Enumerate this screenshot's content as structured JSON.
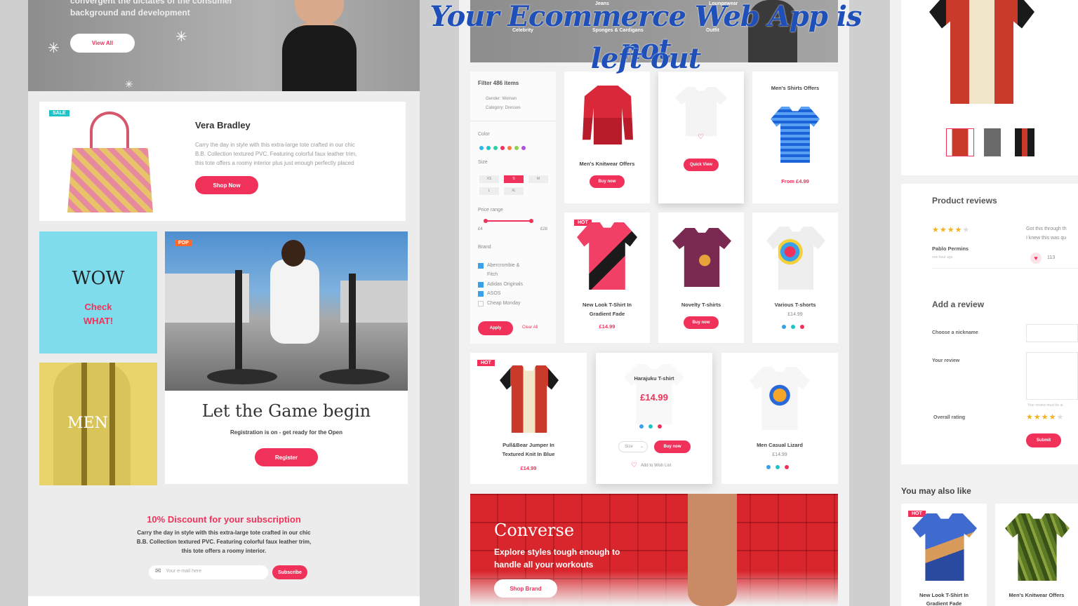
{
  "overlay_title": {
    "line1": "Your Ecommerce Web App is not",
    "line2": "left out"
  },
  "colors": {
    "accent": "#f0325b",
    "teal": "#1fc3c7",
    "sky": "#7edcec",
    "mustard": "#e8d46a",
    "overlay_text": "#1f4fb8"
  },
  "left": {
    "hero": {
      "subtitle_top": "convergent the dictates of the consumer",
      "subtitle": "background and development",
      "button": "View All"
    },
    "feature": {
      "badge": "SALE",
      "title": "Vera Bradley",
      "desc1": "Carry the day in style with this extra-large tote crafted in our chic",
      "desc2": "B.B. Collection textured PVC. Featuring colorful faux leather trim,",
      "desc3": "this tote offers a roomy interior plus just enough perfectly placed",
      "button": "Shop Now"
    },
    "wow": {
      "title": "WOW",
      "line1": "Check",
      "line2": "WHAT!"
    },
    "men": {
      "title": "MEN"
    },
    "game": {
      "badge": "POP",
      "title": "Let the Game begin",
      "subtitle": "Registration is on - get ready for the Open",
      "button": "Register"
    },
    "newsletter": {
      "title": "10% Discount for your subscription",
      "line1": "Carry the day in style with this extra-large tote crafted in our chic",
      "line2": "B.B. Collection textured PVC. Featuring colorful faux leather trim,",
      "line3": "this tote offers a roomy interior.",
      "placeholder": "Your e-mail here",
      "button": "Subscribe"
    }
  },
  "middle": {
    "nav": {
      "item1": "Jeans",
      "item2": "Loungewear",
      "item3": "Celebrity",
      "item4": "Sponges & Cardigans",
      "item5": "Outfit"
    },
    "filter": {
      "title": "Filter 486 items",
      "chip1": "Gender: Woman",
      "chip2": "Category: Dresses",
      "color_label": "Color",
      "size_label": "Size",
      "sizes": [
        "XS",
        "S",
        "M",
        "L",
        "XL"
      ],
      "price_label": "Price range",
      "price_min": "£4",
      "price_max": "£28",
      "brand_label": "Brand",
      "brands": [
        "Abercrombie &",
        "Fitch",
        "Adidas Originals",
        "ASOS",
        "Cheap Monday"
      ],
      "apply": "Apply",
      "clear": "Clear All",
      "swatches": [
        "#2fb6e8",
        "#1fc3c7",
        "#2bd0a0",
        "#f0325b",
        "#ff7a3d",
        "#8fd14f",
        "#b04ee0"
      ]
    },
    "products": {
      "p1": {
        "name": "Men's Knitwear Offers",
        "button": "Buy now"
      },
      "p2": {
        "button": "Quick View"
      },
      "p3": {
        "header": "Men's Shirts Offers",
        "price": "From £4.99"
      },
      "p4": {
        "badge": "HOT",
        "name1": "New Look T-Shirt In",
        "name2": "Gradient Fade",
        "price": "£14.99"
      },
      "p5": {
        "name": "Novelty T-shirts",
        "button": "Buy now"
      },
      "p6": {
        "name": "Various T-shorts",
        "price": "£14.99"
      },
      "p7": {
        "badge": "HOT",
        "name1": "Pull&Bear Jumper In",
        "name2": "Textured Knit In Blue",
        "price": "£14.99"
      },
      "p8": {
        "name": "Harajuku T-shirt",
        "price": "£14.99",
        "size": "Size",
        "button": "Buy now",
        "wishlist": "Add to Wish List"
      },
      "p9": {
        "name": "Men Casual Lizard",
        "price": "£14.99"
      }
    },
    "banner": {
      "title": "Converse",
      "line1": "Explore styles tough enough to",
      "line2": "handle all your workouts",
      "button": "Shop Brand"
    }
  },
  "right": {
    "reviews": {
      "title": "Product reviews",
      "reviewer": "Pablo Permins",
      "time": "one hour ago",
      "text1": "Got this through th",
      "text2": "I knew this was qu",
      "likes": "113",
      "rating_stars": 4
    },
    "add_review": {
      "title": "Add a review",
      "nickname": "Choose a nickname",
      "review": "Your review",
      "rating": "Overall rating",
      "hint": "Your review must be at",
      "submit": "Submit",
      "rating_stars": 4
    },
    "also_like": {
      "title": "You may also like",
      "badge": "HOT",
      "item1a": "New Look T-Shirt In",
      "item1b": "Gradient Fade",
      "item2": "Men's Knitwear Offers"
    }
  }
}
